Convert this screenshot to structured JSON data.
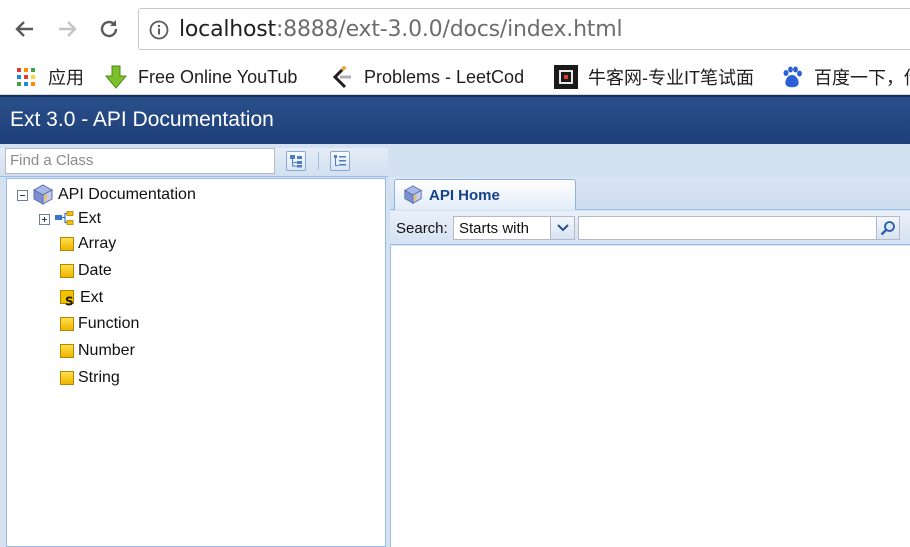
{
  "browser": {
    "url_host": "localhost",
    "url_rest": ":8888/ext-3.0.0/docs/index.html",
    "bookmarks": [
      {
        "label": "应用",
        "icon": "apps-grid-icon"
      },
      {
        "label": "Free Online YouTub",
        "icon": "download-arrow-icon"
      },
      {
        "label": "Problems - LeetCod",
        "icon": "leetcode-icon"
      },
      {
        "label": "牛客网-专业IT笔试面",
        "icon": "nowcoder-icon"
      },
      {
        "label": "百度一下，你",
        "icon": "baidu-paw-icon"
      }
    ]
  },
  "app": {
    "title": "Ext 3.0 - API Documentation"
  },
  "west": {
    "find_placeholder": "Find a Class",
    "tree": {
      "root": "API Documentation",
      "package": "Ext",
      "classes": [
        "Array",
        "Date",
        "Ext",
        "Function",
        "Number",
        "String"
      ]
    }
  },
  "center": {
    "tab_label": "API Home",
    "search_label": "Search:",
    "search_mode": "Starts with",
    "search_value": ""
  }
}
